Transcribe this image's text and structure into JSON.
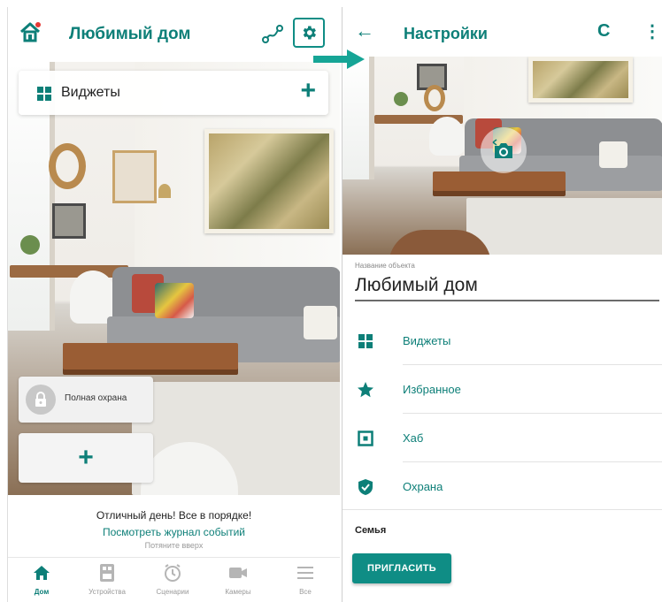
{
  "left": {
    "header": {
      "title": "Любимый дом"
    },
    "widgets_bar": {
      "label": "Виджеты",
      "add": "+"
    },
    "guard_card": {
      "label": "Полная охрана"
    },
    "add_card": {
      "label": "+"
    },
    "status": {
      "message": "Отличный день! Все в порядке!",
      "log_link": "Посмотреть журнал событий",
      "hint": "Потяните вверх"
    },
    "nav": [
      {
        "label": "Дом",
        "icon": "home-icon",
        "active": true
      },
      {
        "label": "Устройства",
        "icon": "devices-icon",
        "active": false
      },
      {
        "label": "Сценарии",
        "icon": "scenarios-icon",
        "active": false
      },
      {
        "label": "Камеры",
        "icon": "camera-icon",
        "active": false
      },
      {
        "label": "Все",
        "icon": "menu-icon",
        "active": false
      }
    ]
  },
  "right": {
    "header": {
      "back": "←",
      "title": "Настройки",
      "refresh": "C",
      "more": "⋮"
    },
    "object_name": {
      "label": "Название объекта",
      "value": "Любимый дом"
    },
    "menu": [
      {
        "label": "Виджеты",
        "icon": "widgets-icon"
      },
      {
        "label": "Избранное",
        "icon": "star-icon"
      },
      {
        "label": "Хаб",
        "icon": "hub-icon"
      },
      {
        "label": "Охрана",
        "icon": "shield-icon"
      }
    ],
    "family": {
      "label": "Семья",
      "invite": "ПРИГЛАСИТЬ"
    }
  },
  "colors": {
    "accent": "#0d7f78",
    "accent_button": "#0f8d85",
    "inactive": "#9a9a9a"
  }
}
